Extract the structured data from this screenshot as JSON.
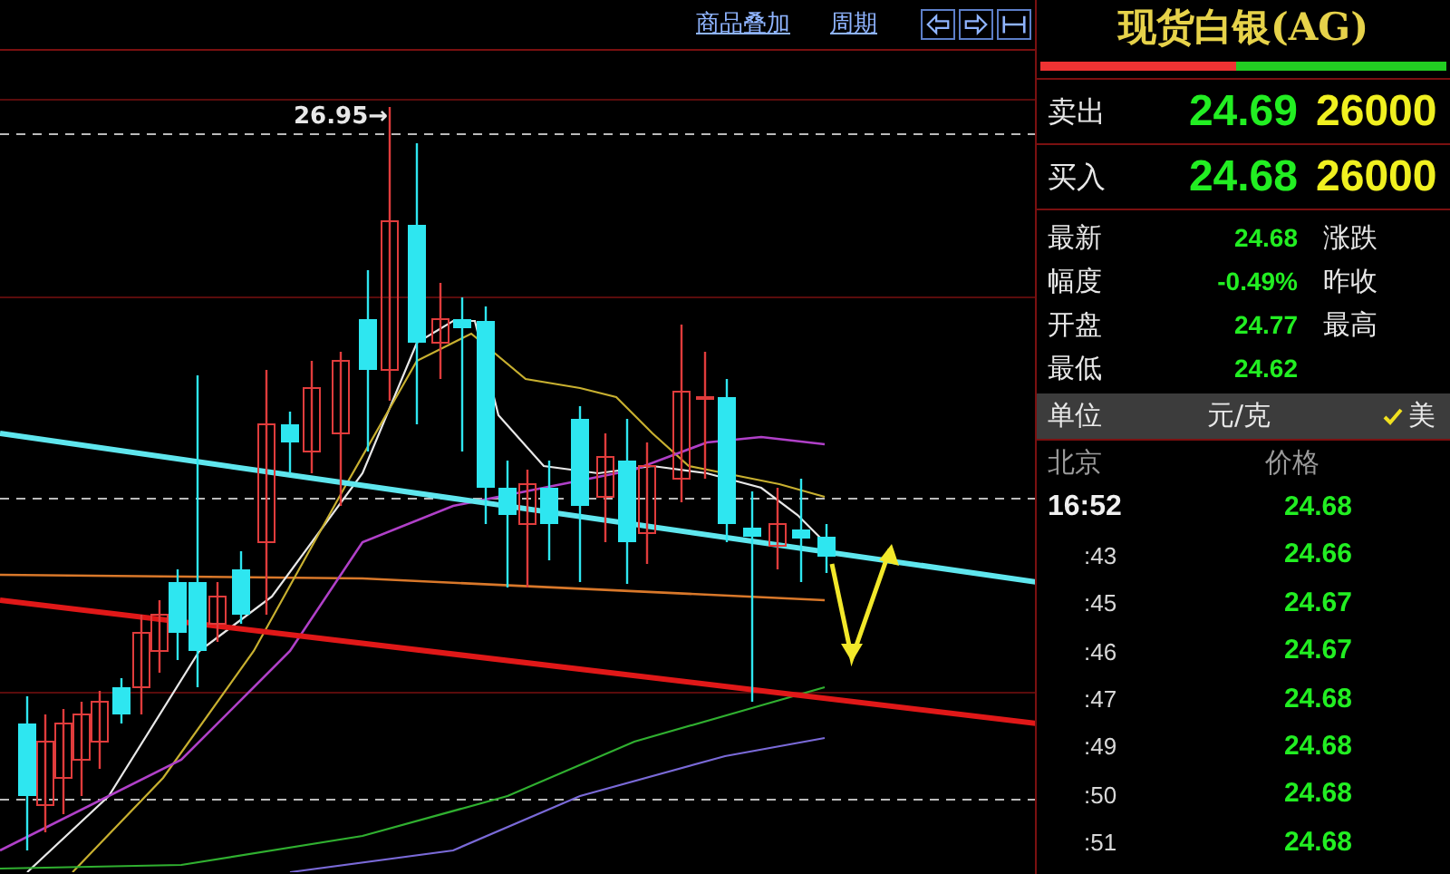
{
  "toolbar": {
    "links": [
      {
        "label": "商品叠加"
      },
      {
        "label": "周期"
      }
    ]
  },
  "chart": {
    "high_label": "26.95→"
  },
  "quote": {
    "title": "现货白银(AG)",
    "ratio": {
      "level": 0.48
    },
    "bid_ask": [
      {
        "label": "卖出",
        "price": "24.69",
        "volume": "26000"
      },
      {
        "label": "买入",
        "price": "24.68",
        "volume": "26000"
      }
    ],
    "stats": [
      {
        "label": "最新",
        "value": "24.68",
        "label2": "涨跌"
      },
      {
        "label": "幅度",
        "value": "-0.49%",
        "label2": "昨收"
      },
      {
        "label": "开盘",
        "value": "24.77",
        "label2": "最高"
      },
      {
        "label": "最低",
        "value": "24.62"
      }
    ],
    "unit": {
      "label": "单位",
      "value": "元/克",
      "option": {
        "label": "美",
        "checked": true
      }
    }
  },
  "ticks": {
    "columns": [
      "北京",
      "价格"
    ],
    "rows": [
      {
        "time": "16:52",
        "price": "24.68"
      },
      {
        "time": ":43",
        "price": "24.66"
      },
      {
        "time": ":45",
        "price": "24.67"
      },
      {
        "time": ":46",
        "price": "24.67"
      },
      {
        "time": ":47",
        "price": "24.68"
      },
      {
        "time": ":49",
        "price": "24.68"
      },
      {
        "time": ":50",
        "price": "24.68"
      },
      {
        "time": ":51",
        "price": "24.68"
      }
    ]
  }
}
